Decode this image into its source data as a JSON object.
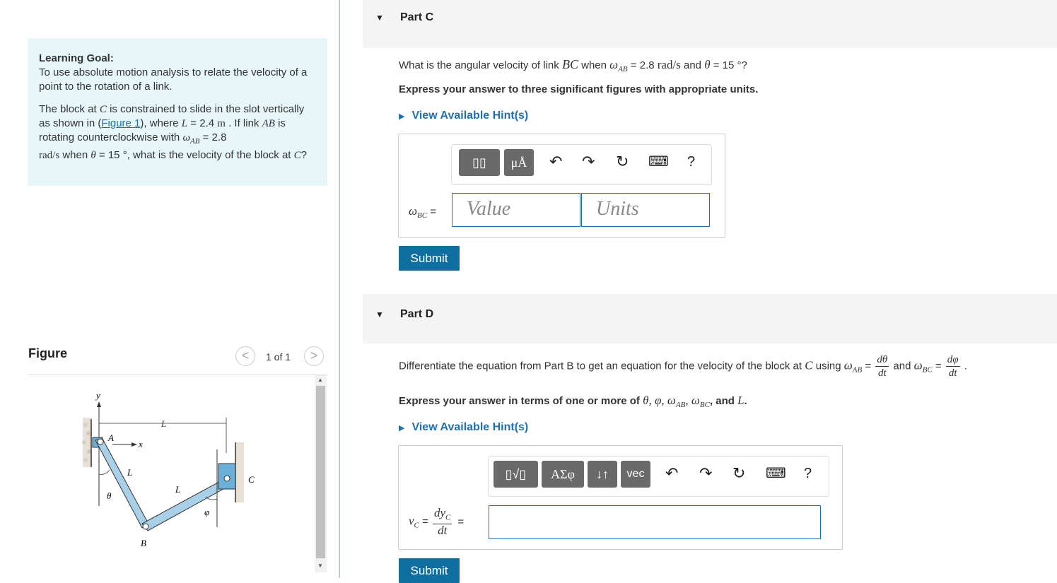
{
  "learning_goal": {
    "title": "Learning Goal:",
    "text": "To use absolute motion analysis to relate the velocity of a point to the rotation of a link.",
    "problem": {
      "p1": "The block at ",
      "C": "C",
      "p2": " is constrained to slide in the slot vertically as shown in (",
      "figure_link": "Figure 1",
      "p3": "), where ",
      "L": "L",
      "p4": " = 2.4 ",
      "m": "m",
      "p5": " . If link ",
      "AB": "AB",
      "p6": " is rotating counterclockwise with ",
      "omega_ab": "ω",
      "omega_ab_sub": "AB",
      "p7": " = 2.8",
      "rads": "rad/s",
      "p8": " when ",
      "theta": "θ",
      "p9": " = 15 °, what is the velocity of the block at ",
      "C2": "C",
      "p10": "?"
    }
  },
  "figure": {
    "title": "Figure",
    "prev": "<",
    "next": ">",
    "pager": "1 of 1",
    "labels": {
      "y": "y",
      "x": "x",
      "A": "A",
      "B": "B",
      "C": "C",
      "L1": "L",
      "L2": "L",
      "L3": "L",
      "theta": "θ",
      "phi": "φ"
    },
    "scroll_up": "▲",
    "scroll_down": "▼"
  },
  "partC": {
    "collapse_icon": "▼",
    "title": "Part C",
    "q_a": "What is the angular velocity of link ",
    "q_BC": "BC",
    "q_b": " when ",
    "q_omega": "ω",
    "q_omega_sub": "AB",
    "q_c": " = 2.8 ",
    "q_rads": "rad/s",
    "q_d": " and ",
    "q_theta": "θ",
    "q_e": " = 15 °?",
    "instructions": "Express your answer to three significant figures with appropriate units.",
    "hint_icon": "▶",
    "hint": "View Available Hint(s)",
    "toolbar": {
      "templates": "▯▯",
      "units": "μÅ",
      "undo": "↶",
      "redo": "↷",
      "reset": "↻",
      "keyboard": "⌨",
      "help": "?"
    },
    "answer_label": "ω",
    "answer_label_sub": "BC",
    "answer_eq": " =",
    "value_placeholder": "Value",
    "units_placeholder": "Units",
    "submit": "Submit"
  },
  "partD": {
    "collapse_icon": "▼",
    "title": "Part D",
    "q_a": "Differentiate the equation from Part B to get an equation for the velocity of the block at ",
    "q_C": "C",
    "q_b": " using ",
    "q_omega_ab": "ω",
    "q_ab_sub": "AB",
    "q_eq": " = ",
    "q_dtheta": "dθ",
    "q_dt": "dt",
    "q_and": " and ",
    "q_omega_bc": "ω",
    "q_bc_sub": "BC",
    "q_eq2": " = ",
    "q_dphi": "dφ",
    "q_dt2": "dt",
    "q_end": " .",
    "instr_a": "Express your answer in terms of one or more of ",
    "instr_vars": "θ, φ, ω",
    "instr_ab": "AB",
    "instr_comma": ", ω",
    "instr_bc": "BC",
    "instr_and": ", and ",
    "instr_L": "L",
    "instr_end": ".",
    "hint_icon": "▶",
    "hint": "View Available Hint(s)",
    "toolbar": {
      "templates": "▯√▯",
      "greek": "ΑΣφ",
      "arrows": "↓↑",
      "vec": "vec",
      "undo": "↶",
      "redo": "↷",
      "reset": "↻",
      "keyboard": "⌨",
      "help": "?"
    },
    "lhs_v": "v",
    "lhs_sub": "C",
    "lhs_eq": " = ",
    "frac_num": "dy",
    "frac_num_sub": "C",
    "frac_den": "dt",
    "rhs_eq": "=",
    "submit": "Submit"
  }
}
